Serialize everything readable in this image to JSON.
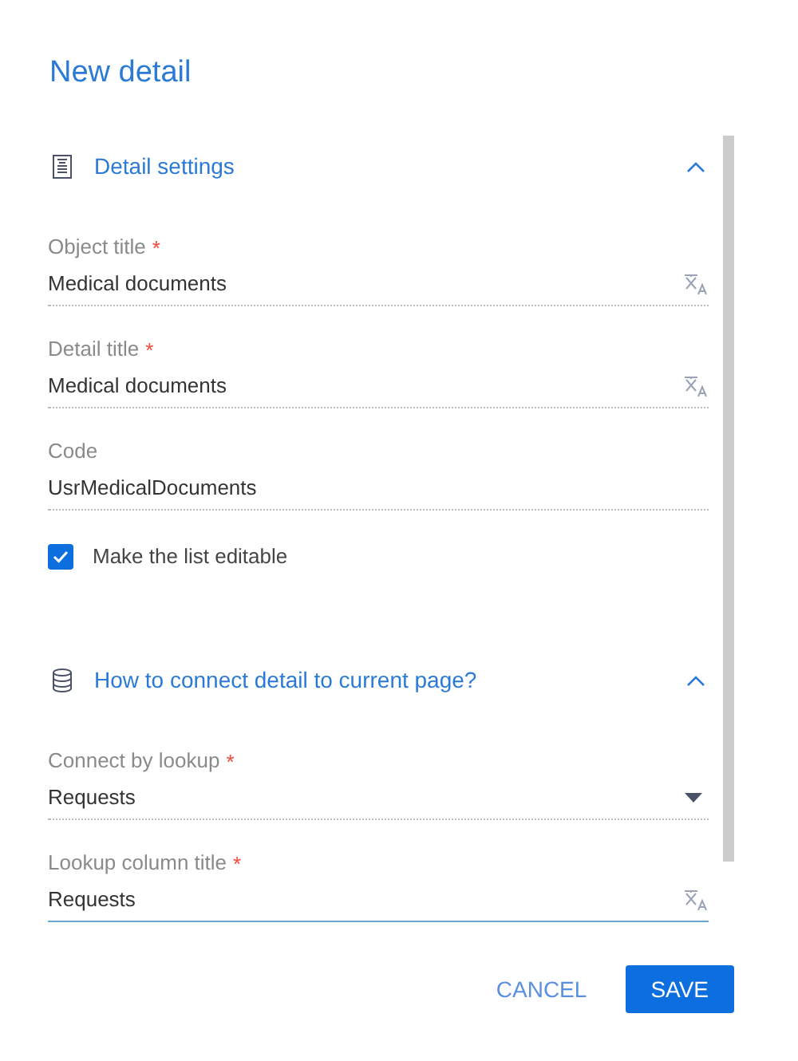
{
  "title": "New detail",
  "sections": [
    {
      "title": "Detail settings",
      "expanded": true,
      "items": [
        {
          "kind": "translatable",
          "label": "Object title",
          "required_mark": "*",
          "value": "Medical documents",
          "focused": false
        },
        {
          "kind": "translatable",
          "label": "Detail title",
          "required_mark": "*",
          "value": "Medical documents",
          "focused": false
        },
        {
          "kind": "text",
          "label": "Code",
          "value": "UsrMedicalDocuments",
          "focused": false
        },
        {
          "kind": "checkbox",
          "label": "Make the list editable",
          "checked": true
        }
      ]
    },
    {
      "title": "How to connect detail to current page?",
      "expanded": true,
      "items": [
        {
          "kind": "lookup",
          "label": "Connect by lookup",
          "required_mark": "*",
          "value": "Requests",
          "focused": false
        },
        {
          "kind": "translatable",
          "label": "Lookup column title",
          "required_mark": "*",
          "value": "Requests",
          "focused": true
        }
      ]
    }
  ],
  "buttons": [
    {
      "label": "CANCEL",
      "kind": "flat"
    },
    {
      "label": "SAVE",
      "kind": "primary"
    }
  ]
}
